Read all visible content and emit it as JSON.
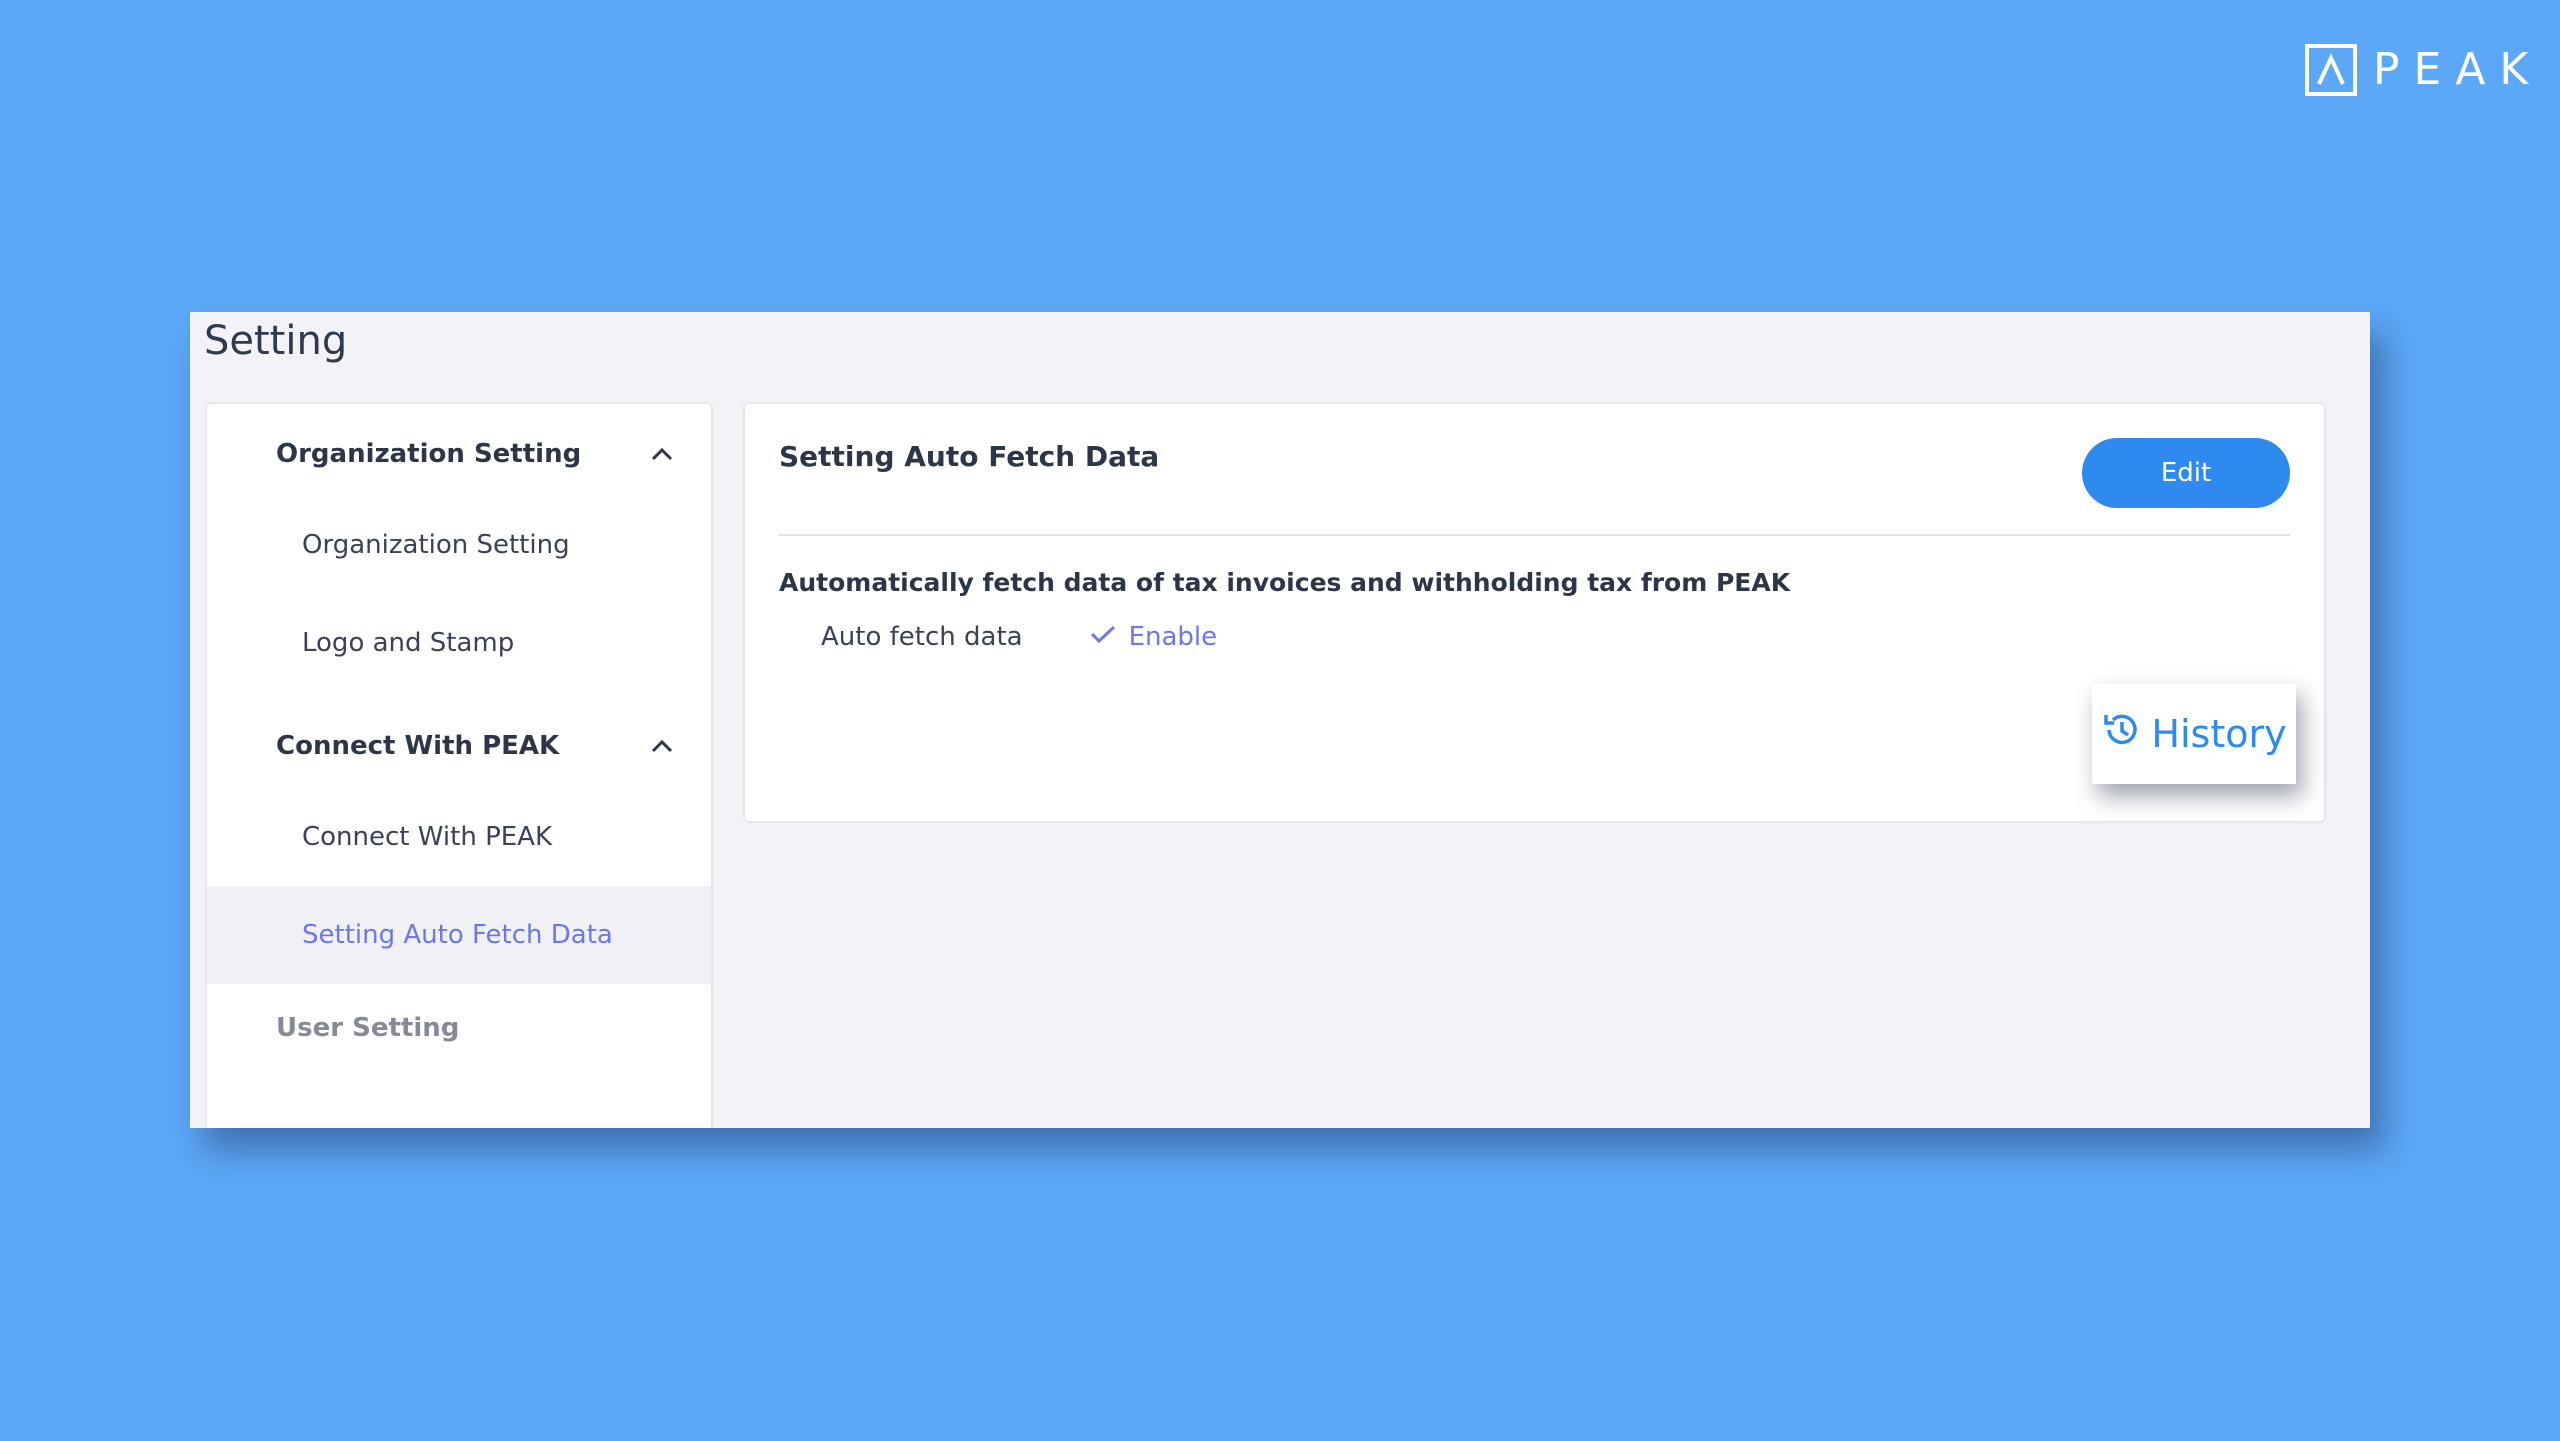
{
  "brand": {
    "name": "PEAK"
  },
  "page": {
    "title": "Setting"
  },
  "sidebar": {
    "groups": [
      {
        "label": "Organization Setting",
        "items": [
          "Organization Setting",
          "Logo and Stamp"
        ]
      },
      {
        "label": "Connect With PEAK",
        "items": [
          "Connect With PEAK",
          "Setting Auto Fetch Data"
        ]
      }
    ],
    "active_item": "Setting Auto Fetch Data",
    "user_setting": "User Setting"
  },
  "content": {
    "title": "Setting Auto Fetch Data",
    "edit_label": "Edit",
    "description": "Automatically fetch data of tax invoices and withholding tax from PEAK",
    "field_label": "Auto fetch data",
    "field_value": "Enable",
    "field_icon": "check-icon"
  },
  "history": {
    "label": "History",
    "icon": "history-icon"
  },
  "colors": {
    "background": "#5ca8f7",
    "accent": "#2f8af0",
    "active_text": "#6b78e6"
  }
}
